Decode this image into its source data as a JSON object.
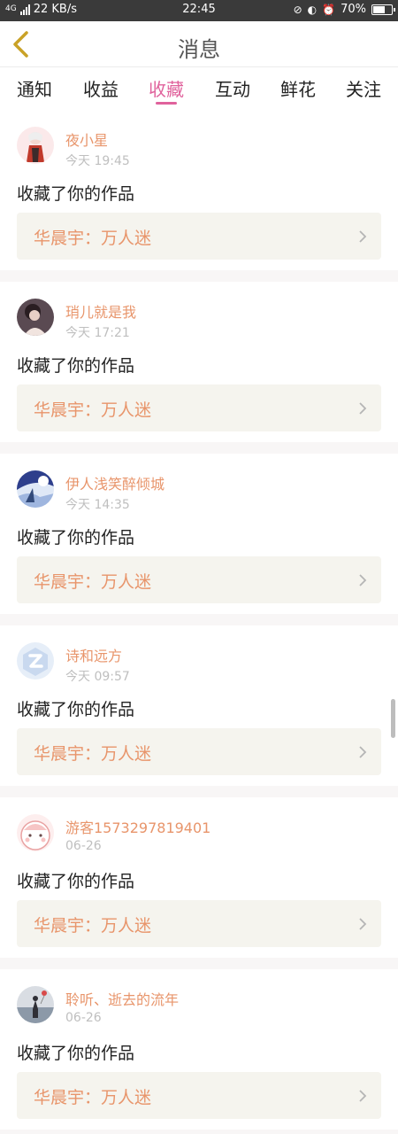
{
  "status_bar": {
    "network": "4G",
    "speed": "22 KB/s",
    "time": "22:45",
    "battery": "70%",
    "battery_level": 0.7
  },
  "header": {
    "title": "消息"
  },
  "tabs": [
    {
      "label": "通知",
      "active": false
    },
    {
      "label": "收益",
      "active": false
    },
    {
      "label": "收藏",
      "active": true
    },
    {
      "label": "互动",
      "active": false
    },
    {
      "label": "鲜花",
      "active": false
    },
    {
      "label": "关注",
      "active": false
    }
  ],
  "items": [
    {
      "user": "夜小星",
      "time": "今天 19:45",
      "action": "收藏了你的作品",
      "work": "华晨宇：万人迷"
    },
    {
      "user": "琑儿就是我",
      "time": "今天 17:21",
      "action": "收藏了你的作品",
      "work": "华晨宇：万人迷"
    },
    {
      "user": "伊人浅笑醉倾城",
      "time": "今天 14:35",
      "action": "收藏了你的作品",
      "work": "华晨宇：万人迷"
    },
    {
      "user": "诗和远方",
      "time": "今天 09:57",
      "action": "收藏了你的作品",
      "work": "华晨宇：万人迷"
    },
    {
      "user": "游客1573297819401",
      "time": "06-26",
      "action": "收藏了你的作品",
      "work": "华晨宇：万人迷"
    },
    {
      "user": "聆听、逝去的流年",
      "time": "06-26",
      "action": "收藏了你的作品",
      "work": "华晨宇：万人迷"
    }
  ],
  "colors": {
    "accent": "#e0629c",
    "username": "#e8956b",
    "back_arrow": "#c9a227"
  }
}
